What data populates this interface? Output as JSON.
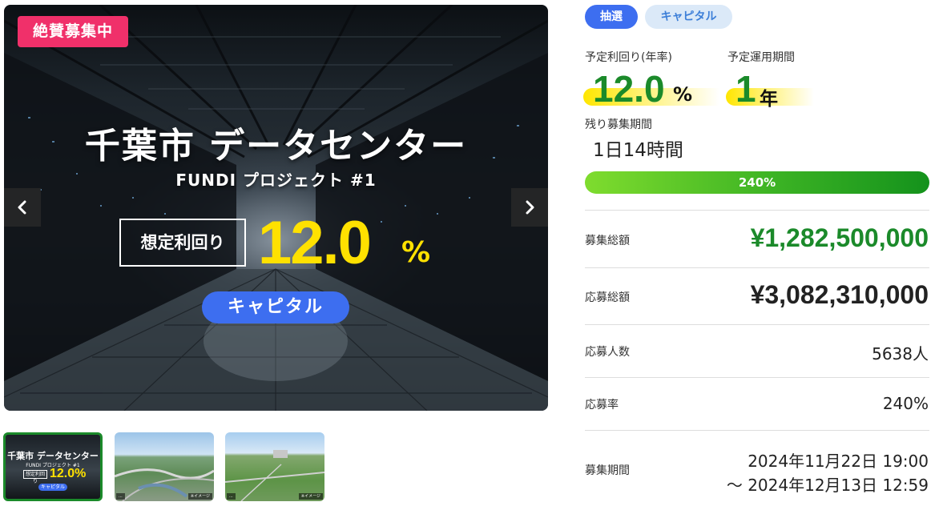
{
  "hero": {
    "badge": "絶賛募集中",
    "title": "千葉市 データセンター",
    "subtitle": "FUNDI プロジェクト #1",
    "yield_label": "想定利回り",
    "yield_value": "12.0",
    "yield_unit": "%",
    "category": "キャピタル"
  },
  "thumbnails": [
    {
      "title": "千葉市 データセンター",
      "subtitle": "FUNDI プロジェクト #1",
      "yield_label": "想定利回り",
      "yield_value": "12.0%",
      "category": "キャピタル"
    },
    {
      "caption_left": "...",
      "caption_right": "※イメージ"
    },
    {
      "caption_left": "...",
      "caption_right": "※イメージ"
    }
  ],
  "tags": {
    "lottery": "抽選",
    "capital": "キャピタル"
  },
  "stats": {
    "yield_label": "予定利回り(年率)",
    "yield_value": "12.0",
    "yield_unit": "%",
    "period_label": "予定運用期間",
    "period_value": "1",
    "period_unit": "年",
    "remaining_label": "残り募集期間",
    "remaining_value": "1日14時間"
  },
  "progress": {
    "label": "240%",
    "fraction": 1.0
  },
  "rows": {
    "total_raise_label": "募集総額",
    "total_raise_value": "¥1,282,500,000",
    "applied_label": "応募総額",
    "applied_value": "¥3,082,310,000",
    "applicants_label": "応募人数",
    "applicants_value": "5638人",
    "rate_label": "応募率",
    "rate_value": "240%",
    "period_label": "募集期間",
    "period_start": "2024年11月22日 19:00",
    "period_end": "〜 2024年12月13日 12:59"
  },
  "colors": {
    "badge": "#f0306a",
    "accent_blue": "#3d6ef0",
    "accent_green": "#1b8a2a",
    "yield_yellow": "#ffe100"
  }
}
